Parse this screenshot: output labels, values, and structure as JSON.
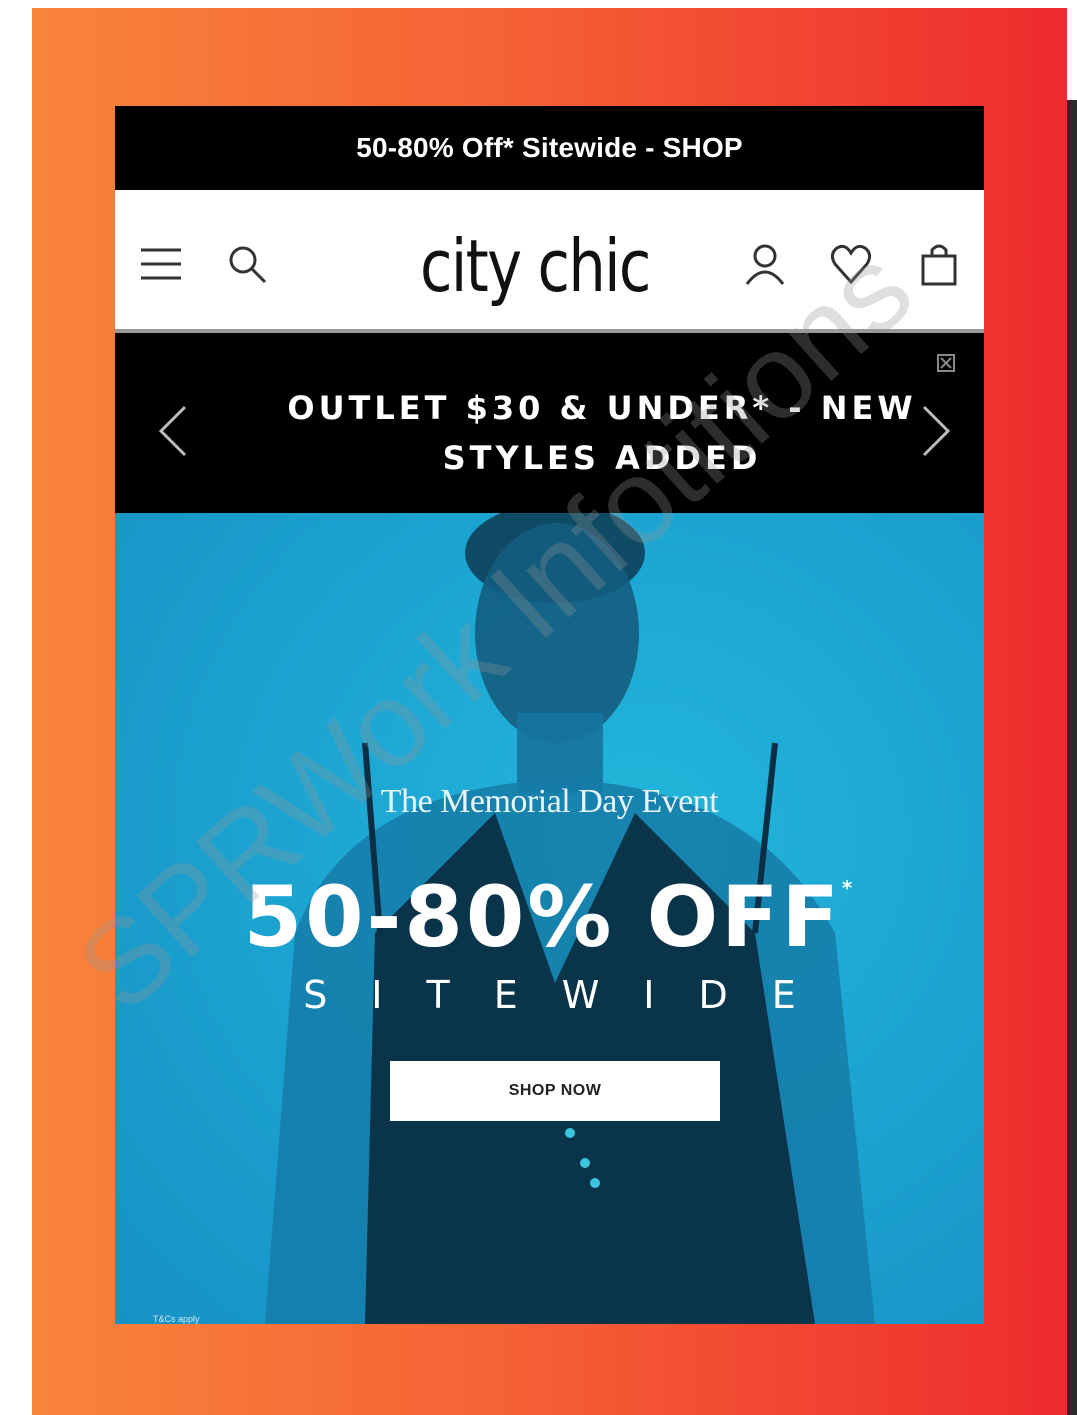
{
  "promo_bar": {
    "text": "50-80% Off* Sitewide - SHOP"
  },
  "header": {
    "logo": "city chic"
  },
  "announcement": {
    "text": "OUTLET $30 & UNDER* - NEW STYLES ADDED"
  },
  "hero": {
    "event_title": "The Memorial Day Event",
    "headline": "50-80% OFF",
    "headline_mark": "*",
    "subheadline": "SITEWIDE",
    "button_label": "SHOP NOW",
    "fine_print": "T&Cs apply"
  },
  "watermark": {
    "text": "SPRWork Infotitions"
  },
  "icons": [
    "menu-icon",
    "search-icon",
    "account-icon",
    "wishlist-heart-icon",
    "bag-icon",
    "chevron-left-icon",
    "chevron-right-icon",
    "close-icon"
  ],
  "colors": {
    "frame_start": "#f8843a",
    "frame_end": "#ee2b2e",
    "hero_blue": "#1da7d3",
    "black": "#000000"
  }
}
